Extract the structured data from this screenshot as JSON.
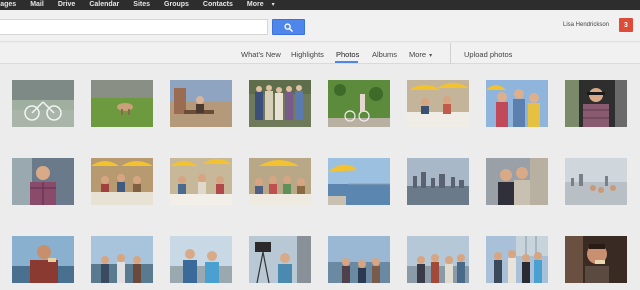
{
  "topbar": {
    "items": [
      "mages",
      "Mail",
      "Drive",
      "Calendar",
      "Sites",
      "Groups",
      "Contacts",
      "More"
    ]
  },
  "search": {
    "value": "",
    "placeholder": "",
    "button_icon": "search-icon",
    "accent_color": "#4f86ec"
  },
  "user": {
    "name": "Lisa Hendrickson",
    "notification_count": "3",
    "notification_color": "#dd4b39"
  },
  "tabs": {
    "items": [
      "What's New",
      "Highlights",
      "Photos",
      "Albums",
      "More"
    ],
    "active": "Photos",
    "upload": "Upload photos"
  },
  "photos": {
    "rows": [
      [
        "bicycle against wall",
        "dog on lawn",
        "person on bench",
        "group of friends",
        "bike by ivy wall",
        "outdoor cafe table",
        "friends selfie",
        "man in plaid shirt"
      ],
      [
        "man in plaid shirt",
        "diners under umbrellas",
        "friends at cafe",
        "group at table",
        "yellow umbrella and bay",
        "city skyline",
        "couple selfie",
        "skyline from terrace"
      ],
      [
        "man eating by water",
        "friends at waterfront",
        "couple on pier",
        "camera on tripod",
        "people on dock",
        "friends on boardwalk",
        "group by boats",
        "man eating"
      ]
    ]
  }
}
